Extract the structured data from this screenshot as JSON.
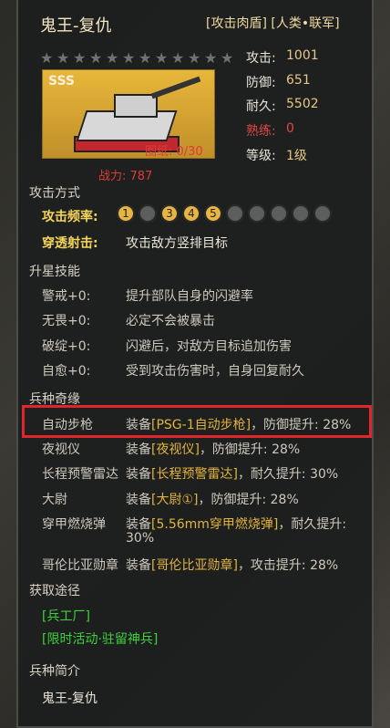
{
  "header": {
    "title": "鬼王-复仇",
    "tags": "[攻击肉盾] [人类•联军]"
  },
  "stars": {
    "total": 12,
    "filled": 0
  },
  "unit_card": {
    "grade": "SSS",
    "blueprint": "图纸: 0/30",
    "power": "战力: 787"
  },
  "stats": [
    {
      "label": "攻击:",
      "value": "1001",
      "highlight": false
    },
    {
      "label": "防御:",
      "value": "651",
      "highlight": false
    },
    {
      "label": "耐久:",
      "value": "5502",
      "highlight": false
    },
    {
      "label": "熟练:",
      "value": "0",
      "highlight": true
    },
    {
      "label": "等级:",
      "value": "1级",
      "highlight": false
    }
  ],
  "attack": {
    "section": "攻击方式",
    "freq_label": "攻击频率:",
    "freq_slots": [
      "1",
      "",
      "3",
      "4",
      "5",
      "",
      "",
      "",
      "",
      ""
    ],
    "pierce_label": "穿透射击:",
    "pierce_desc": "攻击敌方竖排目标"
  },
  "skills": {
    "section": "升星技能",
    "items": [
      {
        "name": "警戒+0:",
        "desc": "提升部队自身的闪避率"
      },
      {
        "name": "无畏+0:",
        "desc": "必定不会被暴击"
      },
      {
        "name": "破绽+0:",
        "desc": "闪避后，对敌方目标追加伤害"
      },
      {
        "name": "自愈+0:",
        "desc": "受到攻击伤害时，自身回复耐久"
      }
    ]
  },
  "fate": {
    "section": "兵种奇缘",
    "items": [
      {
        "name": "自动步枪",
        "pre": "装备",
        "equip": "[PSG-1自动步枪]",
        "post": "，防御提升: 28%"
      },
      {
        "name": "夜视仪",
        "pre": "装备",
        "equip": "[夜视仪]",
        "post": "，防御提升: 28%"
      },
      {
        "name": "长程预警雷达",
        "pre": "装备",
        "equip": "[长程预警雷达]",
        "post": "，耐久提升: 30%"
      },
      {
        "name": "大尉",
        "pre": "装备",
        "equip": "[大尉①]",
        "post": "，防御提升: 28%"
      },
      {
        "name": "穿甲燃烧弹",
        "pre": "装备",
        "equip": "[5.56mm穿甲燃烧弹]",
        "post": "，耐久提升:",
        "post2": "30%"
      },
      {
        "name": "哥伦比亚勋章",
        "pre": "装备",
        "equip": "[哥伦比亚勋章]",
        "post": "，攻击提升: 28%"
      }
    ]
  },
  "source": {
    "section": "获取途径",
    "items": [
      "[兵工厂]",
      "[限时活动·驻留神兵]"
    ]
  },
  "intro": {
    "section": "兵种简介",
    "text": "鬼王-复仇"
  },
  "colors": {
    "accent_gold": "#e6b544",
    "highlight_red": "#e0262a",
    "green_link": "#3ed13a"
  }
}
